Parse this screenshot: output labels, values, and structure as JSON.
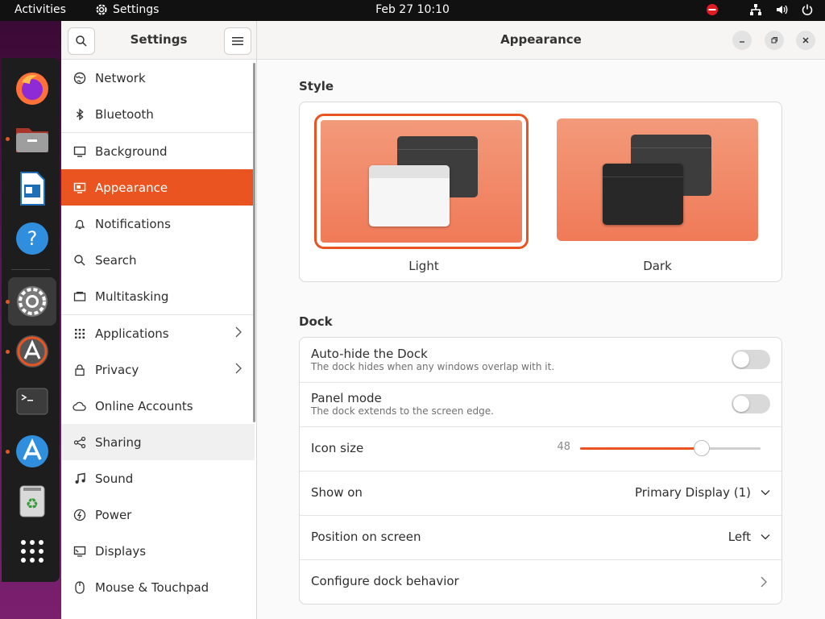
{
  "topbar": {
    "activities": "Activities",
    "app_name": "Settings",
    "clock": "Feb 27  10:10"
  },
  "dock": {
    "apps": [
      "firefox-icon",
      "files-icon",
      "writer-icon",
      "help-icon",
      "settings-icon",
      "software-updater-icon",
      "terminal-icon",
      "app-center-icon",
      "trash-icon",
      "show-apps-icon"
    ]
  },
  "sidebar": {
    "title": "Settings",
    "items": [
      {
        "label": "Network",
        "icon": "globe-icon"
      },
      {
        "label": "Bluetooth",
        "icon": "bluetooth-icon"
      },
      {
        "label": "Background",
        "icon": "monitor-icon"
      },
      {
        "label": "Appearance",
        "icon": "appearance-icon",
        "selected": true
      },
      {
        "label": "Notifications",
        "icon": "bell-icon"
      },
      {
        "label": "Search",
        "icon": "search-icon"
      },
      {
        "label": "Multitasking",
        "icon": "multitasking-icon"
      },
      {
        "label": "Applications",
        "icon": "grid-icon"
      },
      {
        "label": "Privacy",
        "icon": "lock-icon"
      },
      {
        "label": "Online Accounts",
        "icon": "cloud-icon"
      },
      {
        "label": "Sharing",
        "icon": "share-icon"
      },
      {
        "label": "Sound",
        "icon": "music-note-icon"
      },
      {
        "label": "Power",
        "icon": "power-icon"
      },
      {
        "label": "Displays",
        "icon": "display-icon"
      },
      {
        "label": "Mouse & Touchpad",
        "icon": "mouse-icon"
      }
    ]
  },
  "main": {
    "title": "Appearance",
    "style": {
      "section_title": "Style",
      "light_label": "Light",
      "dark_label": "Dark",
      "selected": "Light"
    },
    "dock": {
      "section_title": "Dock",
      "autohide_label": "Auto-hide the Dock",
      "autohide_sub": "The dock hides when any windows overlap with it.",
      "autohide_on": false,
      "panel_label": "Panel mode",
      "panel_sub": "The dock extends to the screen edge.",
      "panel_on": false,
      "icon_size_label": "Icon size",
      "icon_size_value": "48",
      "icon_size_fraction": 0.67,
      "show_on_label": "Show on",
      "show_on_value": "Primary Display (1)",
      "position_label": "Position on screen",
      "position_value": "Left",
      "configure_label": "Configure dock behavior"
    }
  },
  "colors": {
    "accent": "#e95420"
  }
}
